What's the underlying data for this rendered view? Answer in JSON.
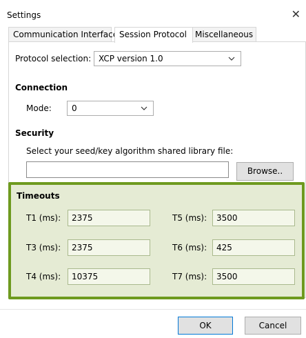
{
  "window": {
    "title": "Settings"
  },
  "tabs": [
    {
      "label": "Communication Interface"
    },
    {
      "label": "Session Protocol"
    },
    {
      "label": "Miscellaneous"
    }
  ],
  "protocol": {
    "label": "Protocol selection:",
    "value": "XCP version 1.0"
  },
  "connection": {
    "heading": "Connection",
    "mode_label": "Mode:",
    "mode_value": "0"
  },
  "security": {
    "heading": "Security",
    "hint": "Select your seed/key algorithm shared library file:",
    "file_value": "",
    "browse_label": "Browse.."
  },
  "timeouts": {
    "heading": "Timeouts",
    "fields": [
      {
        "label": "T1 (ms):",
        "value": "2375"
      },
      {
        "label": "T5 (ms):",
        "value": "3500"
      },
      {
        "label": "T3 (ms):",
        "value": "2375"
      },
      {
        "label": "T6 (ms):",
        "value": "425"
      },
      {
        "label": "T4 (ms):",
        "value": "10375"
      },
      {
        "label": "T7 (ms):",
        "value": "3500"
      }
    ]
  },
  "footer": {
    "ok_label": "OK",
    "cancel_label": "Cancel"
  },
  "colors": {
    "highlight_border": "#6e9a1f",
    "highlight_bg": "#e5ebd4"
  }
}
